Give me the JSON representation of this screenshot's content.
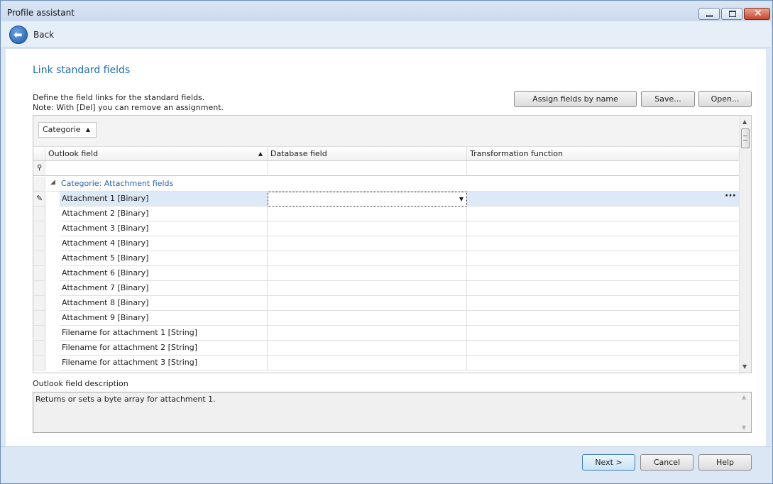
{
  "window": {
    "title": "Profile assistant"
  },
  "nav": {
    "back_label": "Back"
  },
  "page": {
    "heading": "Link standard fields",
    "description_line1": "Define the field links for the standard fields.",
    "description_line2": "Note: With [Del] you can remove an assignment."
  },
  "toolbar": {
    "assign_label": "Assign fields by name",
    "save_label": "Save...",
    "open_label": "Open..."
  },
  "grid": {
    "group_chip_label": "Categorie",
    "columns": [
      "Outlook field",
      "Database field",
      "Transformation function"
    ],
    "group_row_label": "Categorie: Attachment fields",
    "rows": [
      "Attachment 1 [Binary]",
      "Attachment 2 [Binary]",
      "Attachment 3 [Binary]",
      "Attachment 4 [Binary]",
      "Attachment 5 [Binary]",
      "Attachment 6 [Binary]",
      "Attachment 7 [Binary]",
      "Attachment 8 [Binary]",
      "Attachment 9 [Binary]",
      "Filename for attachment 1 [String]",
      "Filename for attachment 2 [String]",
      "Filename for attachment 3 [String]"
    ]
  },
  "description": {
    "label": "Outlook field description",
    "text": "Returns or sets a byte array for attachment 1."
  },
  "footer": {
    "next_label": "Next >",
    "cancel_label": "Cancel",
    "help_label": "Help"
  },
  "colors": {
    "heading": "#1f6eb5",
    "group_label": "#2a63a8",
    "selection": "#dde9f6"
  }
}
